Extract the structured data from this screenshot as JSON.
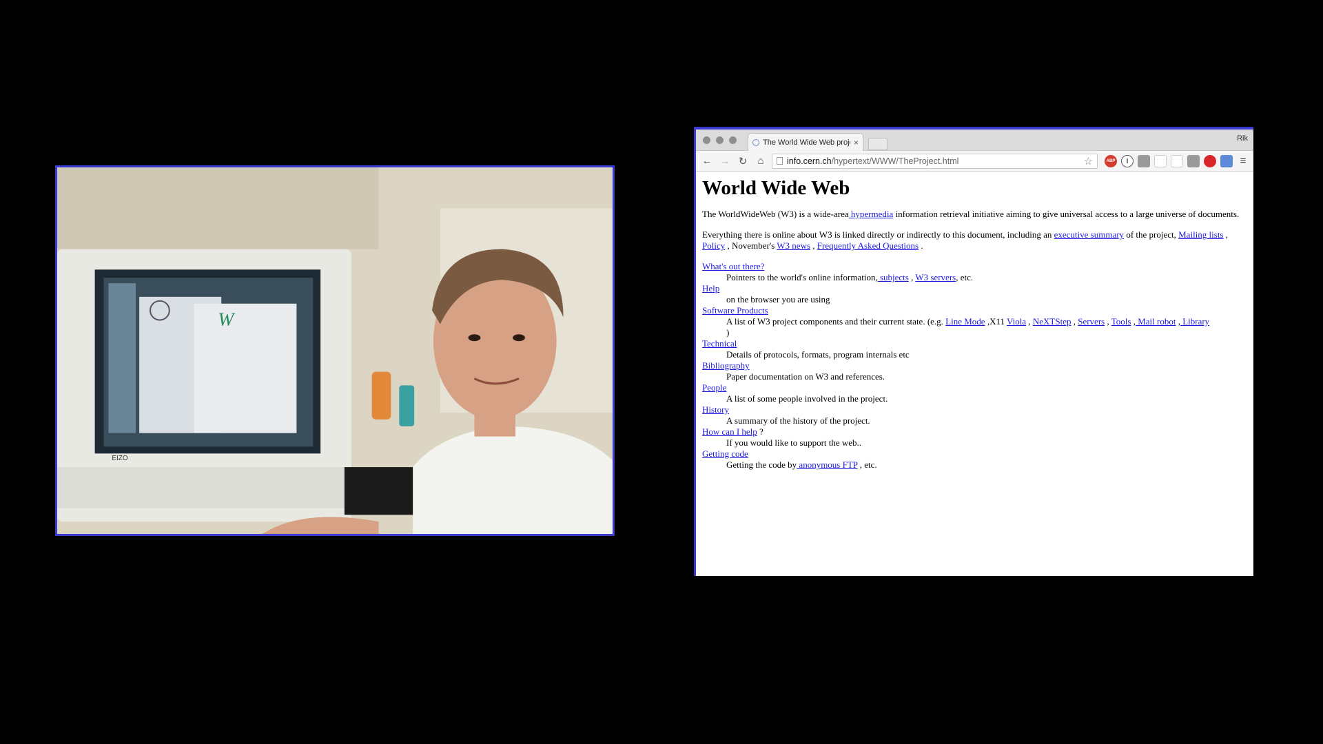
{
  "browser": {
    "tab_title": "The World Wide Web proje",
    "tab_close": "×",
    "profile": "Rik",
    "url_host": "info.cern.ch",
    "url_path": "/hypertext/WWW/TheProject.html",
    "ext_abp": "ABP",
    "ext_info": "i",
    "ext_menu": "≡"
  },
  "page": {
    "title": "World Wide Web",
    "p1": {
      "t1": "The WorldWideWeb (W3) is a wide-area",
      "link": " hypermedia",
      "t2": " information retrieval initiative aiming to give universal access to a large universe of documents."
    },
    "p2": {
      "t1": "Everything there is online about W3 is linked directly or indirectly to this document, including an ",
      "link1": "executive summary",
      "t2": " of the project, ",
      "link2": "Mailing lists",
      "t3": " , ",
      "link3": "Policy",
      "t4": " , November's ",
      "link4": "W3 news",
      "t5": " , ",
      "link5": "Frequently Asked Questions",
      "t6": " ."
    },
    "entries": {
      "whats_out": {
        "term": "What's out there?",
        "d1": "Pointers to the world's online information,",
        "l1": " subjects",
        "d2": " , ",
        "l2": "W3 servers",
        "d3": ", etc."
      },
      "help": {
        "term": "Help",
        "desc": "on the browser you are using"
      },
      "software": {
        "term": "Software Products",
        "d1": "A list of W3 project components and their current state. (e.g. ",
        "l1": "Line Mode",
        "d2": " ,X11 ",
        "l2": "Viola",
        "d3": " , ",
        "l3": "NeXTStep",
        "d4": " , ",
        "l4": "Servers",
        "d5": " , ",
        "l5": "Tools",
        "d6": " ,",
        "l6": " Mail robot",
        "d7": " ,",
        "l7": " Library",
        "d8": " )"
      },
      "technical": {
        "term": "Technical",
        "desc": "Details of protocols, formats, program internals etc"
      },
      "bibliography": {
        "term": "Bibliography",
        "desc": "Paper documentation on W3 and references."
      },
      "people": {
        "term": "People",
        "desc": "A list of some people involved in the project."
      },
      "history": {
        "term": "History",
        "desc": "A summary of the history of the project."
      },
      "howcan": {
        "term": "How can I help",
        "suffix": " ?",
        "desc": "If you would like to support the web.."
      },
      "getting": {
        "term": "Getting code",
        "d1": "Getting the code by",
        "l1": " anonymous FTP",
        "d2": " , etc."
      }
    }
  },
  "colors": {
    "link": "#1a1adb",
    "frame": "#3a3ad0",
    "background": "#000000"
  }
}
